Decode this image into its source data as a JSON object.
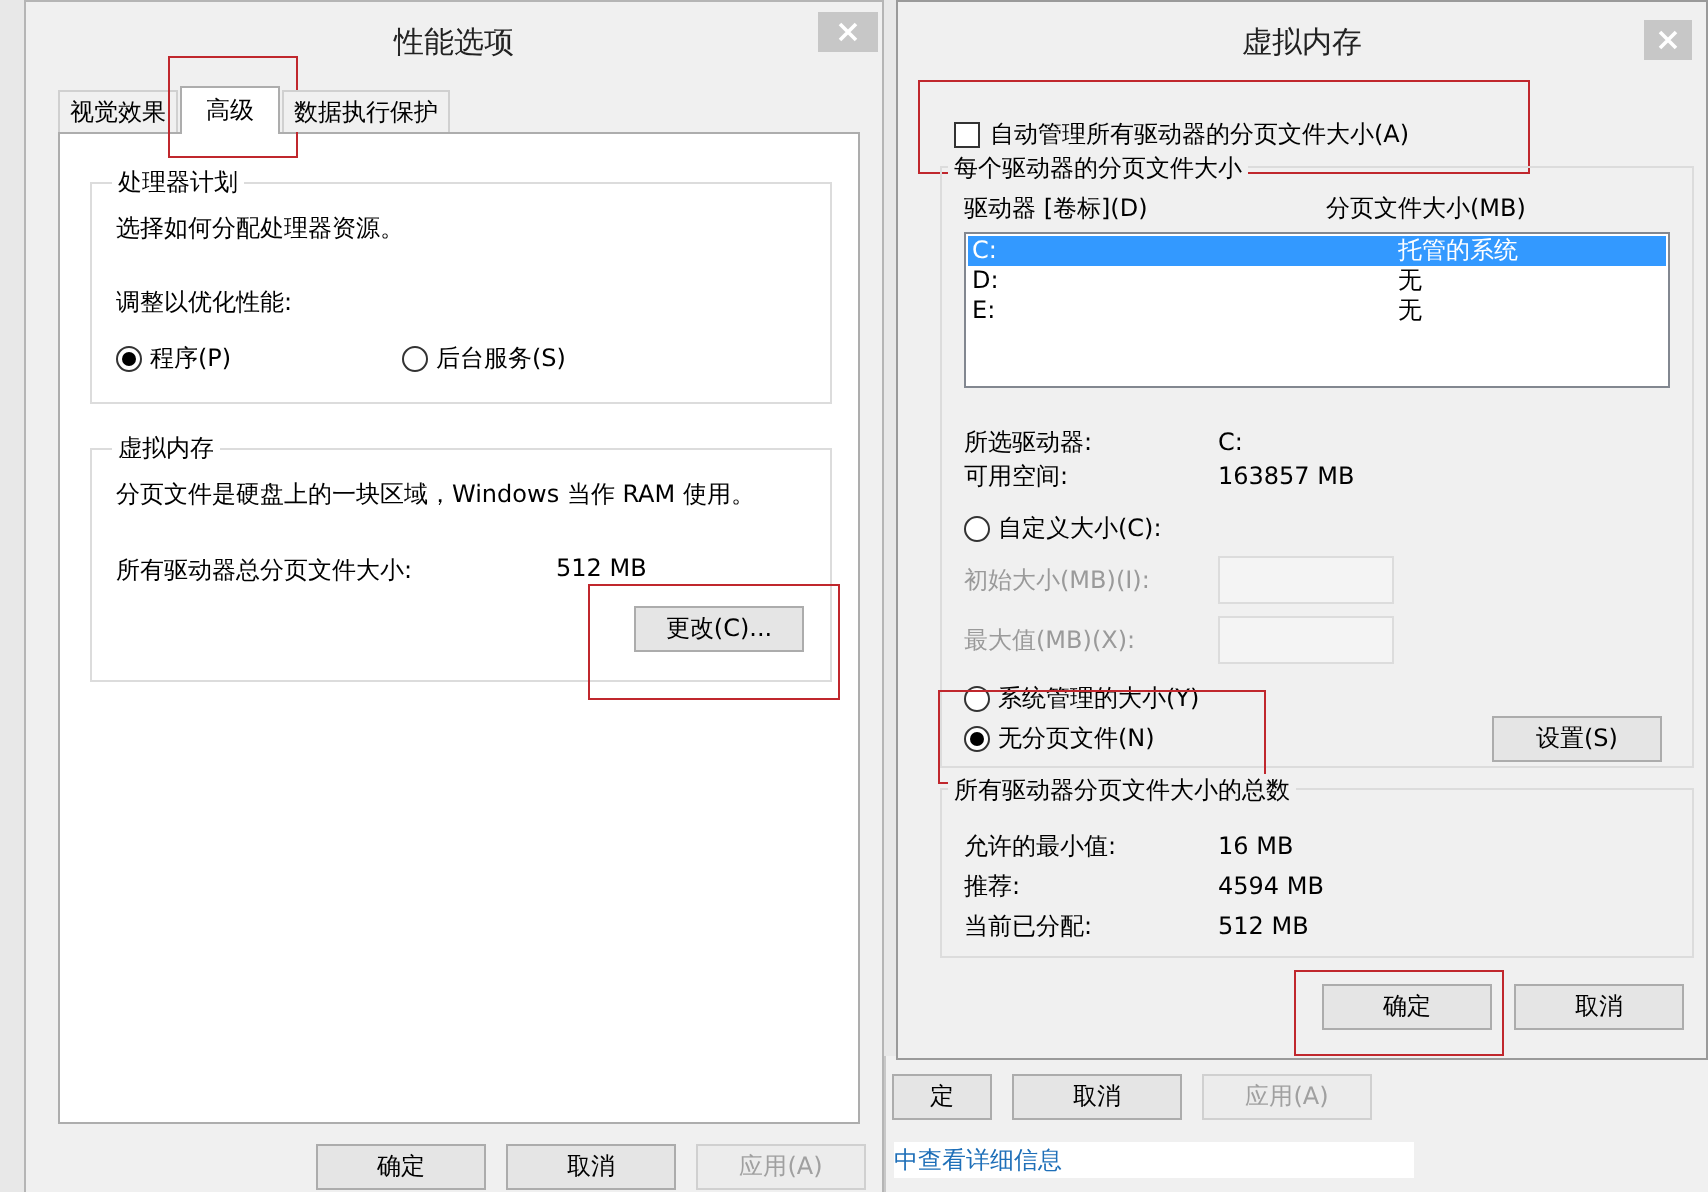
{
  "performance_options": {
    "title": "性能选项",
    "tabs": [
      {
        "label": "视觉效果",
        "selected": false,
        "highlighted": false
      },
      {
        "label": "高级",
        "selected": true,
        "highlighted": true
      },
      {
        "label": "数据执行保护",
        "selected": false,
        "highlighted": false
      }
    ],
    "processor_group": {
      "title": "处理器计划",
      "description": "选择如何分配处理器资源。",
      "prompt": "调整以优化性能:",
      "options": [
        {
          "label": "程序(P)",
          "selected": true
        },
        {
          "label": "后台服务(S)",
          "selected": false
        }
      ]
    },
    "virtual_memory_group": {
      "title": "虚拟内存",
      "description": "分页文件是硬盘上的一块区域，Windows 当作 RAM 使用。",
      "total_label": "所有驱动器总分页文件大小:",
      "total_value": "512 MB",
      "change_button": {
        "label": "更改(C)...",
        "highlighted": true
      }
    },
    "buttons": [
      {
        "label": "确定",
        "disabled": false,
        "highlighted": false
      },
      {
        "label": "取消",
        "disabled": false,
        "highlighted": false
      },
      {
        "label": "应用(A)",
        "disabled": true,
        "highlighted": false
      }
    ]
  },
  "virtual_memory": {
    "title": "虚拟内存",
    "auto_manage": {
      "label": "自动管理所有驱动器的分页文件大小(A)",
      "checked": false,
      "highlighted": true
    },
    "per_drive_group": {
      "title": "每个驱动器的分页文件大小",
      "columns": [
        "驱动器 [卷标](D)",
        "分页文件大小(MB)"
      ],
      "drives": [
        {
          "drive": "C:",
          "size": "托管的系统",
          "selected": true
        },
        {
          "drive": "D:",
          "size": "无",
          "selected": false
        },
        {
          "drive": "E:",
          "size": "无",
          "selected": false
        }
      ],
      "selected_drive_label": "所选驱动器:",
      "selected_drive": "C:",
      "free_space_label": "可用空间:",
      "free_space": "163857 MB",
      "custom_size": {
        "label": "自定义大小(C):",
        "selected": false
      },
      "initial_size": {
        "label": "初始大小(MB)(I):",
        "disabled": true
      },
      "maximum_size": {
        "label": "最大值(MB)(X):",
        "disabled": true
      },
      "system_managed": {
        "label": "系统管理的大小(Y)",
        "selected": false
      },
      "no_paging_file": {
        "label": "无分页文件(N)",
        "selected": true,
        "highlighted": true
      },
      "set_button": {
        "label": "设置(S)"
      }
    },
    "totals_group": {
      "title": "所有驱动器分页文件大小的总数",
      "rows": [
        {
          "label": "允许的最小值:",
          "value": "16 MB"
        },
        {
          "label": "推荐:",
          "value": "4594 MB"
        },
        {
          "label": "当前已分配:",
          "value": "512 MB"
        }
      ]
    },
    "buttons": [
      {
        "label": "确定",
        "highlighted": true
      },
      {
        "label": "取消",
        "highlighted": false
      }
    ]
  },
  "background_window": {
    "buttons": [
      {
        "label": "定",
        "disabled": false
      },
      {
        "label": "取消",
        "disabled": false
      },
      {
        "label": "应用(A)",
        "disabled": true
      }
    ],
    "link": "中查看详细信息"
  }
}
